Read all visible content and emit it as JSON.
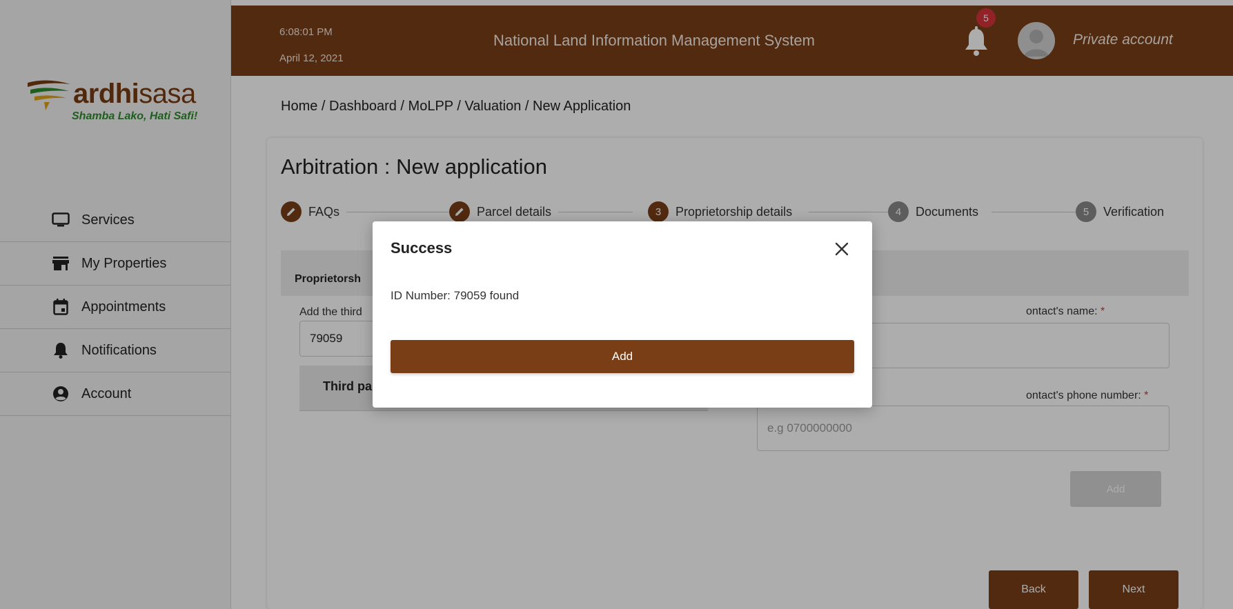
{
  "header": {
    "time": "6:08:01 PM",
    "date": "April 12, 2021",
    "system_title": "National Land Information Management System",
    "notification_count": "5",
    "account_label": "Private account"
  },
  "logo": {
    "word_bold": "ardhi",
    "word_light": "sasa",
    "tagline": "Shamba Lako, Hati Safi!"
  },
  "sidebar": {
    "items": [
      {
        "label": "Services",
        "icon": "monitor-icon"
      },
      {
        "label": "My Properties",
        "icon": "store-icon"
      },
      {
        "label": "Appointments",
        "icon": "calendar-icon"
      },
      {
        "label": "Notifications",
        "icon": "bell-icon"
      },
      {
        "label": "Account",
        "icon": "user-circle-icon"
      }
    ]
  },
  "breadcrumb": "Home /  Dashboard /  MoLPP /  Valuation /  New Application",
  "page": {
    "title": "Arbitration : New application",
    "steps": [
      {
        "label": "FAQs",
        "marker": "",
        "state": "done"
      },
      {
        "label": "Parcel details",
        "marker": "",
        "state": "done"
      },
      {
        "label": "Proprietorship details",
        "marker": "3",
        "state": "active"
      },
      {
        "label": "Documents",
        "marker": "4",
        "state": "pending"
      },
      {
        "label": "Verification",
        "marker": "5",
        "state": "pending"
      }
    ],
    "section_label": "Proprietorsh",
    "left_label": "Add the third",
    "left_input_value": "79059",
    "table_header": "Third pa",
    "right_label_1": "ontact's name:",
    "right_label_2": "ontact's phone number:",
    "required_mark": "*",
    "phone_placeholder": "e.g 0700000000",
    "add_label": "Add",
    "back_label": "Back",
    "next_label": "Next"
  },
  "modal": {
    "title": "Success",
    "message": "ID Number: 79059 found",
    "add_label": "Add"
  },
  "colors": {
    "brand_brown": "#7a3e17",
    "badge_red": "#d6343c",
    "logo_green": "#2e8b2e"
  }
}
